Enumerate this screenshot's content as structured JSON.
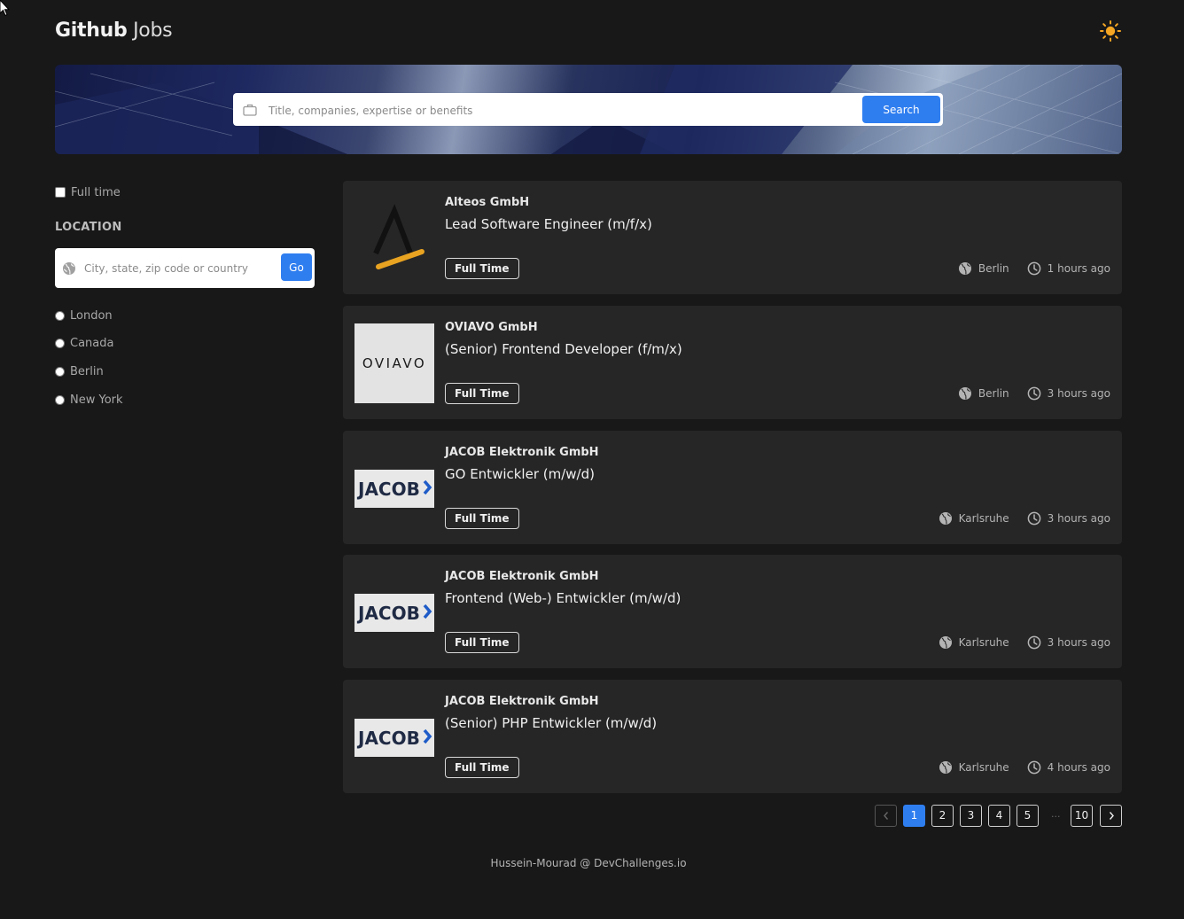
{
  "header": {
    "brand_bold": "Github",
    "brand_light": "Jobs",
    "theme_icon": "sun-icon"
  },
  "search": {
    "placeholder": "Title, companies, expertise or benefits",
    "button_label": "Search"
  },
  "filters": {
    "full_time_label": "Full time",
    "full_time_checked": false,
    "location_title": "LOCATION",
    "location_placeholder": "City, state, zip code or country",
    "go_label": "Go",
    "locations": [
      "London",
      "Canada",
      "Berlin",
      "New York"
    ]
  },
  "jobs": [
    {
      "company": "Alteos GmbH",
      "title": "Lead Software Engineer (m/f/x)",
      "type": "Full Time",
      "location": "Berlin",
      "posted": "1 hours ago",
      "logo": "alteos-logo"
    },
    {
      "company": "OVIAVO GmbH",
      "title": "(Senior) Frontend Developer (f/m/x)",
      "type": "Full Time",
      "location": "Berlin",
      "posted": "3 hours ago",
      "logo": "oviavo-logo",
      "logo_text": "OVIAVO"
    },
    {
      "company": "JACOB Elektronik GmbH",
      "title": "GO Entwickler (m/w/d)",
      "type": "Full Time",
      "location": "Karlsruhe",
      "posted": "3 hours ago",
      "logo": "jacob-logo",
      "logo_text": "JACOB"
    },
    {
      "company": "JACOB Elektronik GmbH",
      "title": "Frontend (Web-) Entwickler (m/w/d)",
      "type": "Full Time",
      "location": "Karlsruhe",
      "posted": "3 hours ago",
      "logo": "jacob-logo",
      "logo_text": "JACOB"
    },
    {
      "company": "JACOB Elektronik GmbH",
      "title": "(Senior) PHP Entwickler (m/w/d)",
      "type": "Full Time",
      "location": "Karlsruhe",
      "posted": "4 hours ago",
      "logo": "jacob-logo",
      "logo_text": "JACOB"
    }
  ],
  "pagination": {
    "pages": [
      "1",
      "2",
      "3",
      "4",
      "5"
    ],
    "ellipsis": "...",
    "last_page": "10",
    "current": "1"
  },
  "footer": {
    "text": "Hussein-Mourad @ DevChallenges.io"
  },
  "colors": {
    "background": "#181818",
    "card": "#262626",
    "accent": "#2f7ef0",
    "sun": "#f5a623"
  }
}
